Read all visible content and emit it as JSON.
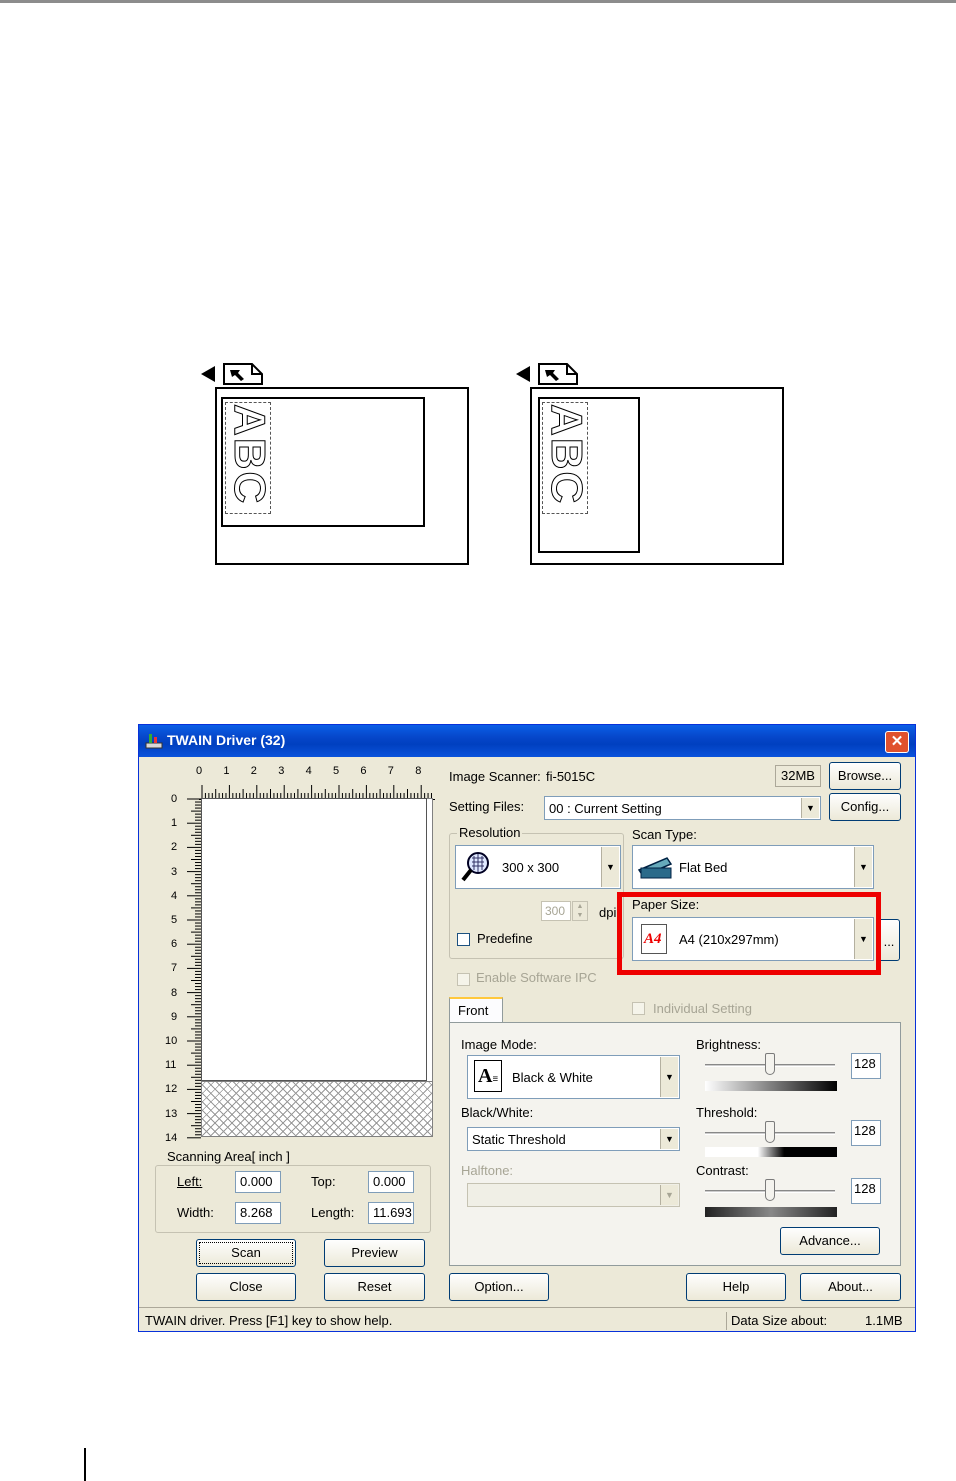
{
  "illustration": {
    "left_text": "ABC",
    "right_text": "ABC"
  },
  "window": {
    "title": "TWAIN Driver (32)",
    "close_glyph": "✕",
    "ruler": {
      "h_ticks": [
        "0",
        "1",
        "2",
        "3",
        "4",
        "5",
        "6",
        "7",
        "8"
      ],
      "v_ticks": [
        "0",
        "1",
        "2",
        "3",
        "4",
        "5",
        "6",
        "7",
        "8",
        "9",
        "10",
        "11",
        "12",
        "13",
        "14"
      ]
    },
    "scanning_area": {
      "label": "Scanning Area[ inch ]",
      "left_label": "Left:",
      "left_value": "0.000",
      "top_label": "Top:",
      "top_value": "0.000",
      "width_label": "Width:",
      "width_value": "8.268",
      "length_label": "Length:",
      "length_value": "11.693"
    },
    "buttons": {
      "scan": "Scan",
      "preview": "Preview",
      "close": "Close",
      "reset": "Reset",
      "option": "Option...",
      "help": "Help",
      "about": "About...",
      "browse": "Browse...",
      "config": "Config...",
      "advance": "Advance...",
      "paper_more": "..."
    },
    "image_scanner": {
      "label": "Image Scanner:",
      "value": "fi-5015C",
      "memory": "32MB"
    },
    "setting_files": {
      "label": "Setting Files:",
      "value": "00 : Current Setting"
    },
    "resolution": {
      "label": "Resolution",
      "value": "300 x 300",
      "custom_value": "300",
      "unit": "dpi",
      "predefine_label": "Predefine"
    },
    "scan_type": {
      "label": "Scan Type:",
      "value": "Flat Bed"
    },
    "paper_size": {
      "label": "Paper Size:",
      "value": "A4 (210x297mm)",
      "icon_text": "A4"
    },
    "enable_software_ipc": "Enable Software IPC",
    "tab": {
      "label": "Front"
    },
    "individual_setting": "Individual Setting",
    "image_mode": {
      "label": "Image Mode:",
      "value": "Black & White"
    },
    "black_white": {
      "label": "Black/White:",
      "value": "Static Threshold"
    },
    "halftone": {
      "label": "Halftone:",
      "value": ""
    },
    "brightness": {
      "label": "Brightness:",
      "value": "128",
      "level": 0.5
    },
    "threshold": {
      "label": "Threshold:",
      "value": "128",
      "level": 0.5
    },
    "contrast": {
      "label": "Contrast:",
      "value": "128",
      "level": 0.5
    },
    "status": {
      "message": "TWAIN driver. Press [F1] key to show help.",
      "data_size_label": "Data Size about:",
      "data_size_value": "1.1MB"
    },
    "colors": {
      "titlebar": "#0a52db",
      "highlight": "#ee0000",
      "window_bg": "#ece9d8"
    }
  }
}
